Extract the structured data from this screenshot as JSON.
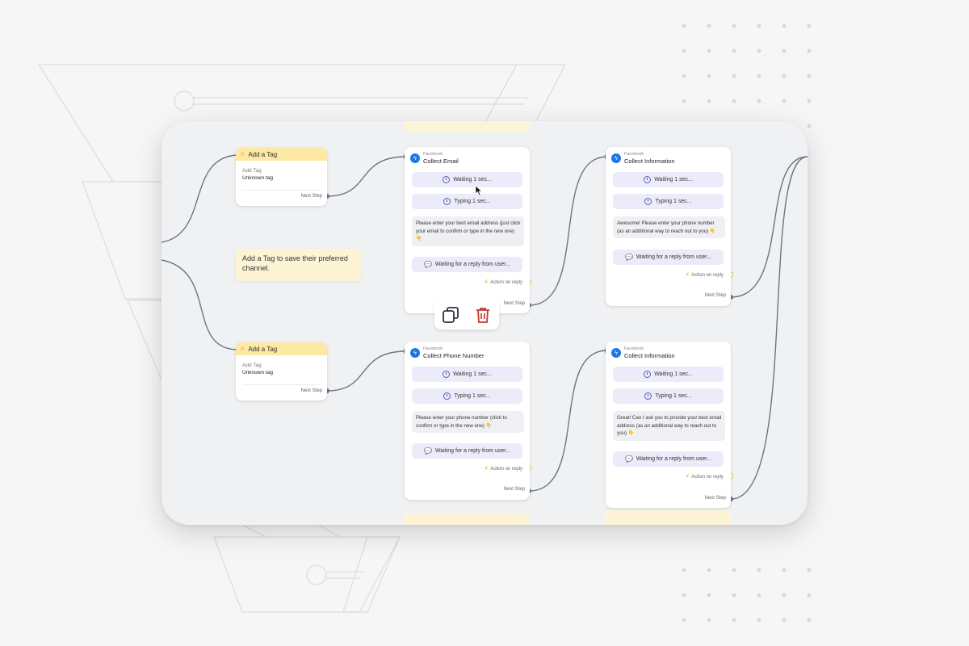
{
  "colors": {
    "tag_header": "#fde8a4",
    "note_bg": "#fdf4d6",
    "pill_bg": "#ecebfa",
    "messenger_blue": "#1b78e5",
    "connector": "#6c7585",
    "delete_red": "#c0392b"
  },
  "tag_nodes": [
    {
      "title": "Add a Tag",
      "label": "Add Tag",
      "value": "Unknown tag",
      "next": "Next Step"
    },
    {
      "title": "Add a Tag",
      "label": "Add Tag",
      "value": "Unknown tag",
      "next": "Next Step"
    }
  ],
  "note": {
    "text": "Add a Tag to save their preferred channel."
  },
  "fb_nodes": [
    {
      "platform": "Facebook",
      "title": "Collect Email",
      "wait": "Waiting 1 sec...",
      "typing": "Typing 1 sec...",
      "message": "Please enter your best email address (just click your email to confirm or type in the new one) 👇",
      "reply": "Waiting for a reply from user...",
      "action": "Action on reply",
      "next": "Next Step"
    },
    {
      "platform": "Facebook",
      "title": "Collect Information",
      "wait": "Waiting 1 sec...",
      "typing": "Typing 1 sec...",
      "message": "Awesome! Please enter your phone number (as an additional way to reach out to you) 👇",
      "reply": "Waiting for a reply from user...",
      "action": "Action on reply",
      "next": "Next Step"
    },
    {
      "platform": "Facebook",
      "title": "Collect Phone Number",
      "wait": "Waiting 1 sec...",
      "typing": "Typing 1 sec...",
      "message": "Please enter your phone number (click to confirm or type in the new one) 👇",
      "reply": "Waiting for a reply from user...",
      "action": "Action on reply",
      "next": "Next Step"
    },
    {
      "platform": "Facebook",
      "title": "Collect Information",
      "wait": "Waiting 1 sec...",
      "typing": "Typing 1 sec...",
      "message": "Great! Can I ask you to provide your best email address (as an additional way to reach out to you) 👇",
      "reply": "Waiting for a reply from user...",
      "action": "Action on reply",
      "next": "Next Step"
    }
  ],
  "icons": {
    "duplicate": "copy-icon",
    "delete": "trash-icon",
    "bolt": "⚡",
    "messenger": "messenger-icon"
  }
}
